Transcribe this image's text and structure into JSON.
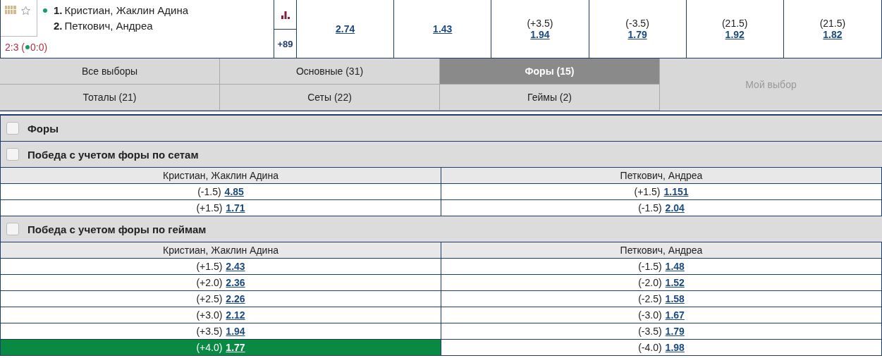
{
  "match": {
    "favorite": false,
    "live": true,
    "players": [
      {
        "number": "1.",
        "name": "Кристиан, Жаклин Адина"
      },
      {
        "number": "2.",
        "name": "Петкович, Андреа"
      }
    ],
    "score_prefix": "2:3 (",
    "score_suffix": "0:0)",
    "more_count": "+89",
    "odds": [
      {
        "odds": "2.74"
      },
      {
        "odds": "1.43"
      },
      {
        "line": "(+3.5)",
        "odds": "1.94"
      },
      {
        "line": "(-3.5)",
        "odds": "1.79"
      },
      {
        "line": "(21.5)",
        "odds": "1.92"
      },
      {
        "line": "(21.5)",
        "odds": "1.82"
      }
    ]
  },
  "tabs": [
    {
      "label": "Все выборы",
      "selected": false
    },
    {
      "label": "Основные (31)",
      "selected": false
    },
    {
      "label": "Форы (15)",
      "selected": true
    },
    {
      "label": "Тоталы (21)",
      "selected": false
    },
    {
      "label": "Сеты (22)",
      "selected": false
    },
    {
      "label": "Геймы (2)",
      "selected": false
    }
  ],
  "my_choice": {
    "label": "Мой выбор",
    "disabled": true
  },
  "sections": [
    {
      "title": "Форы",
      "checked": false
    },
    {
      "title": "Победа с учетом форы по сетам",
      "checked": false,
      "columns": [
        "Кристиан, Жаклин Адина",
        "Петкович, Андреа"
      ],
      "rows": [
        [
          {
            "line": "(-1.5)",
            "odds": "4.85",
            "selected": false
          },
          {
            "line": "(+1.5)",
            "odds": "1.151",
            "selected": false
          }
        ],
        [
          {
            "line": "(+1.5)",
            "odds": "1.71",
            "selected": false
          },
          {
            "line": "(-1.5)",
            "odds": "2.04",
            "selected": false
          }
        ]
      ]
    },
    {
      "title": "Победа с учетом форы по геймам",
      "checked": false,
      "columns": [
        "Кристиан, Жаклин Адина",
        "Петкович, Андреа"
      ],
      "rows": [
        [
          {
            "line": "(+1.5)",
            "odds": "2.43",
            "selected": false
          },
          {
            "line": "(-1.5)",
            "odds": "1.48",
            "selected": false
          }
        ],
        [
          {
            "line": "(+2.0)",
            "odds": "2.36",
            "selected": false
          },
          {
            "line": "(-2.0)",
            "odds": "1.52",
            "selected": false
          }
        ],
        [
          {
            "line": "(+2.5)",
            "odds": "2.26",
            "selected": false
          },
          {
            "line": "(-2.5)",
            "odds": "1.58",
            "selected": false
          }
        ],
        [
          {
            "line": "(+3.0)",
            "odds": "2.12",
            "selected": false
          },
          {
            "line": "(-3.0)",
            "odds": "1.67",
            "selected": false
          }
        ],
        [
          {
            "line": "(+3.5)",
            "odds": "1.94",
            "selected": false
          },
          {
            "line": "(-3.5)",
            "odds": "1.79",
            "selected": false
          }
        ],
        [
          {
            "line": "(+4.0)",
            "odds": "1.77",
            "selected": true
          },
          {
            "line": "(-4.0)",
            "odds": "1.98",
            "selected": false
          }
        ]
      ]
    }
  ]
}
